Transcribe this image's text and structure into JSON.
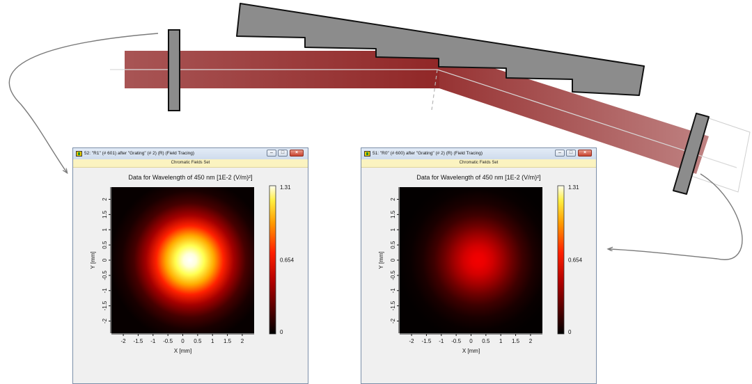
{
  "colors": {
    "beam": "#8b1c1c",
    "component_fill": "#8c8c8c",
    "component_stroke": "#111111",
    "arrow": "#7a7a7a",
    "axis_line": "#d9d9d9",
    "subbar": "#fbf3c0"
  },
  "window_controls": {
    "minimize": "–",
    "maximize": "□",
    "close": "×"
  },
  "windows": [
    {
      "title": "52: \"R1\" (# 601) after \"Grating\" (# 2) (R) (Field Tracing)",
      "subtitle": "Chromatic Fields Set",
      "plot_title": "Data for Wavelength of 450 nm  [1E-2 (V/m)²]",
      "x_label": "X [mm]",
      "y_label": "Y [mm]",
      "x_ticks": [
        "-2",
        "-1.5",
        "-1",
        "-0.5",
        "0",
        "0.5",
        "1",
        "1.5",
        "2"
      ],
      "y_ticks": [
        "2",
        "1.5",
        "1",
        "0.5",
        "0",
        "-0.5",
        "-1",
        "-1.5",
        "-2"
      ],
      "colorbar_labels": [
        "1.31",
        "0.654",
        "0"
      ],
      "peak_value": 1.31,
      "colorbar_max": 1.31
    },
    {
      "title": "51: \"R0\" (# 600) after \"Grating\" (# 2) (R) (Field Tracing)",
      "subtitle": "Chromatic Fields Set",
      "plot_title": "Data for Wavelength of 450 nm  [1E-2 (V/m)²]",
      "x_label": "X [mm]",
      "y_label": "Y [mm]",
      "x_ticks": [
        "-2",
        "-1.5",
        "-1",
        "-0.5",
        "0",
        "0.5",
        "1",
        "1.5",
        "2"
      ],
      "y_ticks": [
        "2",
        "1.5",
        "1",
        "0.5",
        "0",
        "-0.5",
        "-1",
        "-1.5",
        "-2"
      ],
      "colorbar_labels": [
        "1.31",
        "0.654",
        "0"
      ],
      "peak_value": 0.5,
      "colorbar_max": 1.31
    }
  ]
}
